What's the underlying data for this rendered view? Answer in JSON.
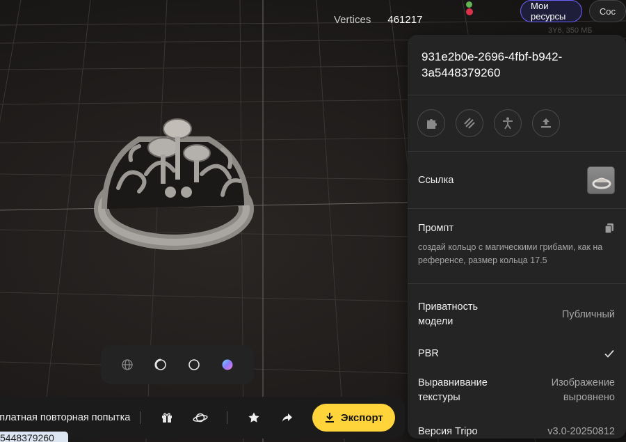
{
  "viewport": {
    "vertices_label": "Vertices",
    "vertices_value": "461217"
  },
  "top_buttons": {
    "my_resources": "Мои ресурсы",
    "community": "Сос"
  },
  "background_text": "3Y6, 350 МБ",
  "panel": {
    "title": "931e2b0e-2696-4fbf-b942-3a5448379260",
    "icons": [
      "puzzle-icon",
      "texture-icon",
      "rig-icon",
      "retopology-icon"
    ],
    "reference_label": "Ссылка",
    "prompt_label": "Промпт",
    "prompt_text": "создай кольцо с магическими грибами, как на референсе, размер кольца 17.5",
    "privacy_label": "Приватность модели",
    "privacy_value": "Публичный",
    "pbr_label": "PBR",
    "pbr_checked": true,
    "texture_align_label": "Выравнивание текстуры",
    "texture_align_value": "Изображение выровнено",
    "version_label": "Версия Tripo",
    "version_value": "v3.0-20250812"
  },
  "view_modes": [
    "wireframe-globe-icon",
    "clay-shaded-icon",
    "outline-circle-icon",
    "color-sphere-icon"
  ],
  "toolbar": {
    "retry_text": "сплатная повторная попытка",
    "export_label": "Экспорт"
  },
  "id_chip": "5448379260",
  "colors": {
    "accent_purple": "#6c63ff",
    "export_yellow": "#ffd43a",
    "panel_bg": "#242424"
  }
}
